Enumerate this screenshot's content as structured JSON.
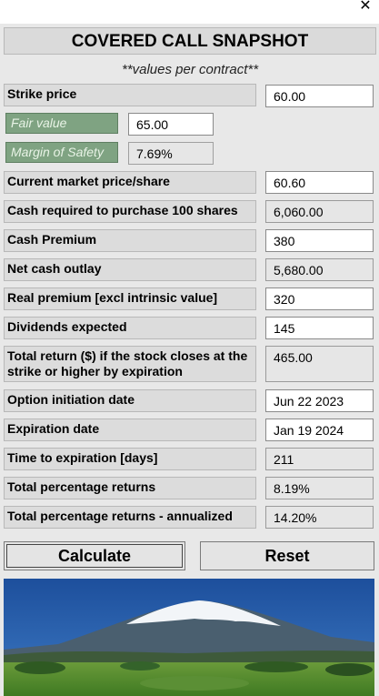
{
  "window": {
    "close_glyph": "✕"
  },
  "title": "COVERED CALL SNAPSHOT",
  "subtitle": "**values per contract**",
  "strike": {
    "label": "Strike price",
    "value": "60.00"
  },
  "fair_value": {
    "label": "Fair value",
    "value": "65.00"
  },
  "margin_of_safety": {
    "label": "Margin of Safety",
    "value": "7.69%"
  },
  "rows": [
    {
      "label": "Current market price/share",
      "value": "60.60"
    },
    {
      "label": "Cash required to purchase 100 shares",
      "value": "6,060.00"
    },
    {
      "label": "Cash Premium",
      "value": "380"
    },
    {
      "label": "Net cash outlay",
      "value": "5,680.00"
    },
    {
      "label": "Real premium [excl intrinsic value]",
      "value": "320"
    },
    {
      "label": "Dividends expected",
      "value": "145"
    },
    {
      "label": "Total return ($) if the stock closes at the strike or higher by expiration",
      "value": "465.00"
    },
    {
      "label": "Option initiation date",
      "value": "Jun 22 2023"
    },
    {
      "label": "Expiration date",
      "value": "Jan 19 2024"
    },
    {
      "label": "Time to expiration [days]",
      "value": "211"
    },
    {
      "label": "Total percentage returns",
      "value": "8.19%"
    },
    {
      "label": "Total percentage returns - annualized",
      "value": "14.20%"
    }
  ],
  "buttons": {
    "calculate": "Calculate",
    "reset": "Reset"
  },
  "colors": {
    "sky": "#1e5aa8",
    "snow": "#ffffff",
    "grass": "#4e8a2a",
    "label_green": "#7fa382"
  }
}
